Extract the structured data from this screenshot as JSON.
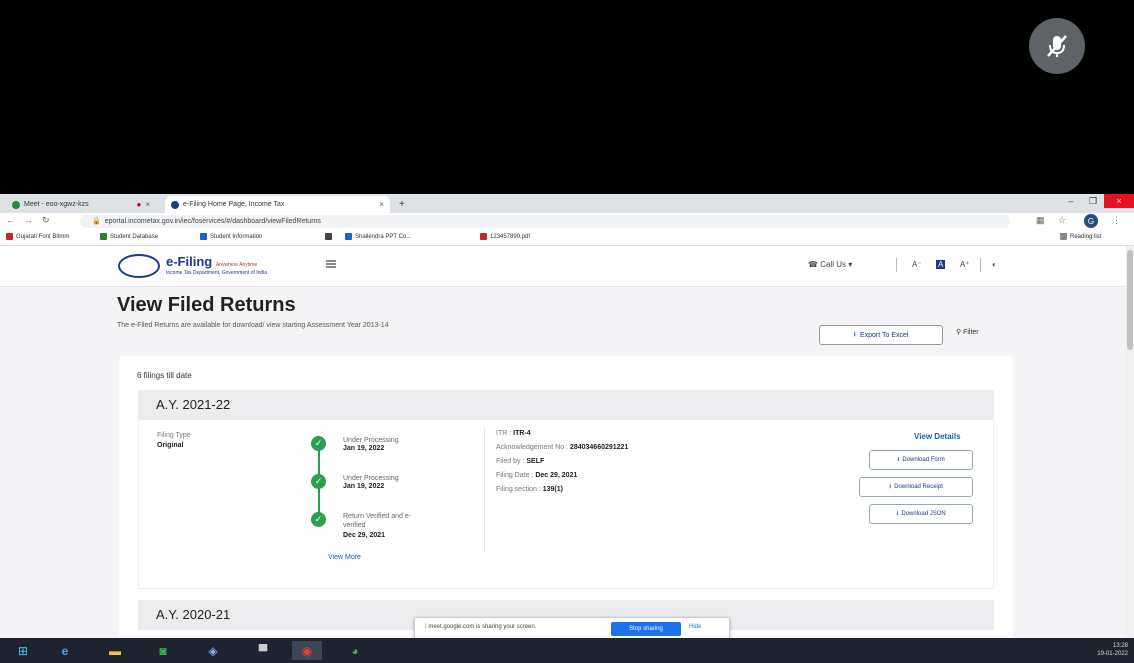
{
  "browser": {
    "tabs": [
      {
        "title": "Meet - eoo-xgwz-kzs",
        "color": "#1e8e3e",
        "active": false
      },
      {
        "title": "e-Filing Home Page, Income Tax",
        "color": "#1a3a8a",
        "active": true
      }
    ],
    "new_tab": "+",
    "url": "eportal.incometax.gov.in/iec/foservices/#/dashboard/viewFiledReturns",
    "profile_initial": "G",
    "bookmarks": [
      {
        "label": "Gujarati Font Bitmm",
        "color": "#c62828"
      },
      {
        "label": "Student Database",
        "color": "#2e7d32"
      },
      {
        "label": "Student Information",
        "color": "#1565c0"
      },
      {
        "label": "",
        "color": "#444444"
      },
      {
        "label": "Shailendra PPT Co...",
        "color": "#1565c0"
      },
      {
        "label": "123457890.pdf",
        "color": "#c62828"
      }
    ],
    "reading_list": "Reading list"
  },
  "site": {
    "logo_title": "e-Filing",
    "logo_tagline": "Anywhere Anytime",
    "logo_sub": "Income Tax Department, Government of India",
    "call_us": "Call Us",
    "font_controls": [
      "A⁻",
      "A",
      "A⁺"
    ]
  },
  "page": {
    "title": "View Filed Returns",
    "subtitle": "The e-Filed Returns are available for download/ view starting Assessment Year 2013-14",
    "export_label": "Export To Excel",
    "filter_label": "Filter",
    "filings_count": "6 filings till date"
  },
  "returns": [
    {
      "ay": "A.Y. 2021-22",
      "filing_type_label": "Filing Type",
      "filing_type_value": "Original",
      "steps": [
        {
          "status": "Under Processing",
          "date": "Jan 19, 2022"
        },
        {
          "status": "Under Processing",
          "date": "Jan 19, 2022"
        },
        {
          "status": "Return Verified and e-verified",
          "date": "Dec 29, 2021"
        }
      ],
      "view_more": "View More",
      "itr_label": "ITR :",
      "itr_value": "ITR-4",
      "ack_label": "Acknowledgement No :",
      "ack_value": "284034660291221",
      "filed_by_label": "Filed by :",
      "filed_by_value": "SELF",
      "filing_date_label": "Filing Date :",
      "filing_date_value": "Dec 29, 2021",
      "filing_section_label": "Filing section :",
      "filing_section_value": "139(1)",
      "view_details": "View Details",
      "buttons": [
        "Download Form",
        "Download Receipt",
        "Download JSON"
      ]
    },
    {
      "ay": "A.Y. 2020-21"
    }
  ],
  "share_banner": {
    "text": "meet.google.com is sharing your screen.",
    "stop": "Stop sharing",
    "hide": "Hide"
  },
  "tray": {
    "time": "13:28",
    "date": "19-01-2022"
  }
}
